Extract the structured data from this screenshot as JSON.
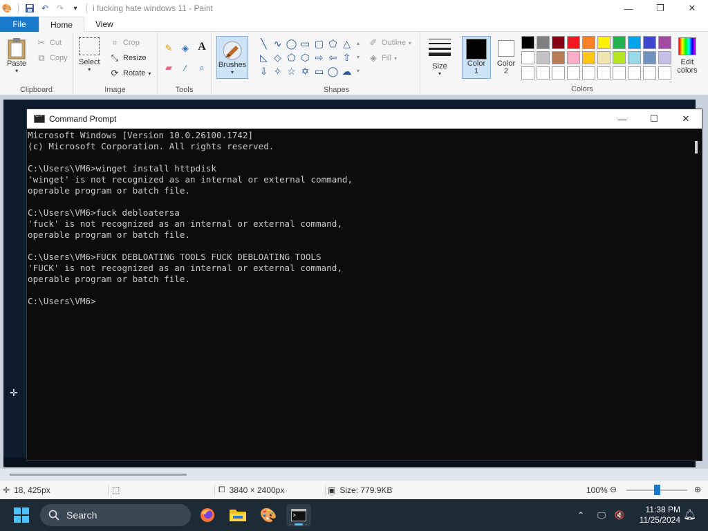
{
  "window": {
    "title": "i fucking hate windows 11 - Paint"
  },
  "tabs": {
    "file": "File",
    "home": "Home",
    "view": "View"
  },
  "ribbon": {
    "clipboard": {
      "label": "Clipboard",
      "paste": "Paste",
      "cut": "Cut",
      "copy": "Copy"
    },
    "image": {
      "label": "Image",
      "select": "Select",
      "crop": "Crop",
      "resize": "Resize",
      "rotate": "Rotate"
    },
    "tools": {
      "label": "Tools"
    },
    "brushes": {
      "label": "Brushes"
    },
    "shapes": {
      "label": "Shapes",
      "outline": "Outline",
      "fill": "Fill"
    },
    "size": {
      "label": "Size"
    },
    "color1": {
      "label": "Color",
      "index": "1",
      "value": "#000000"
    },
    "color2": {
      "label": "Color",
      "index": "2",
      "value": "#ffffff"
    },
    "colors": {
      "label": "Colors",
      "edit": "Edit colors"
    },
    "palette": [
      "#000000",
      "#7f7f7f",
      "#880015",
      "#ed1c24",
      "#ff7f27",
      "#fff200",
      "#22b14c",
      "#00a2e8",
      "#3f48cc",
      "#a349a4",
      "#ffffff",
      "#c3c3c3",
      "#b97a57",
      "#ffaec9",
      "#ffc90e",
      "#efe4b0",
      "#b5e61d",
      "#99d9ea",
      "#7092be",
      "#c8bfe7",
      "#ffffff",
      "#ffffff",
      "#ffffff",
      "#ffffff",
      "#ffffff",
      "#ffffff",
      "#ffffff",
      "#ffffff",
      "#ffffff",
      "#ffffff"
    ]
  },
  "cmd": {
    "title": "Command Prompt",
    "lines": [
      "Microsoft Windows [Version 10.0.26100.1742]",
      "(c) Microsoft Corporation. All rights reserved.",
      "",
      "C:\\Users\\VM6>winget install httpdisk",
      "'winget' is not recognized as an internal or external command,",
      "operable program or batch file.",
      "",
      "C:\\Users\\VM6>fuck debloatersa",
      "'fuck' is not recognized as an internal or external command,",
      "operable program or batch file.",
      "",
      "C:\\Users\\VM6>FUCK DEBLOATING TOOLS FUCK DEBLOATING TOOLS",
      "'FUCK' is not recognized as an internal or external command,",
      "operable program or batch file.",
      "",
      "C:\\Users\\VM6>"
    ]
  },
  "status": {
    "cursor": "18, 425px",
    "dimensions": "3840 × 2400px",
    "size": "Size: 779.9KB",
    "zoom": "100%"
  },
  "taskbar": {
    "search": "Search",
    "time": "11:38 PM",
    "date": "11/25/2024"
  }
}
